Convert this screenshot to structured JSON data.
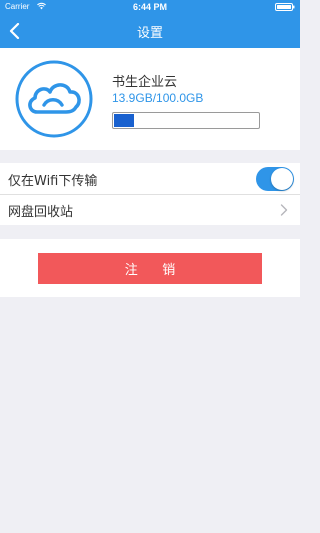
{
  "status_bar": {
    "carrier": "Carrier",
    "time": "6:44 PM"
  },
  "nav": {
    "title": "设置",
    "back_icon": "chevron-left-icon"
  },
  "profile": {
    "logo_icon": "cloud-icon",
    "company_name": "书生企业云",
    "storage_text": "13.9GB/100.0GB",
    "storage_used_fraction": 0.139
  },
  "settings": {
    "wifi_only_label": "仅在Wifi下传输",
    "wifi_only_enabled": true,
    "recycle_bin_label": "网盘回收站"
  },
  "actions": {
    "logout_label": "注 销"
  },
  "colors": {
    "primary": "#2f95e8",
    "storage_fill": "#1961cf",
    "logout": "#f2585a",
    "background": "#efeff4"
  }
}
